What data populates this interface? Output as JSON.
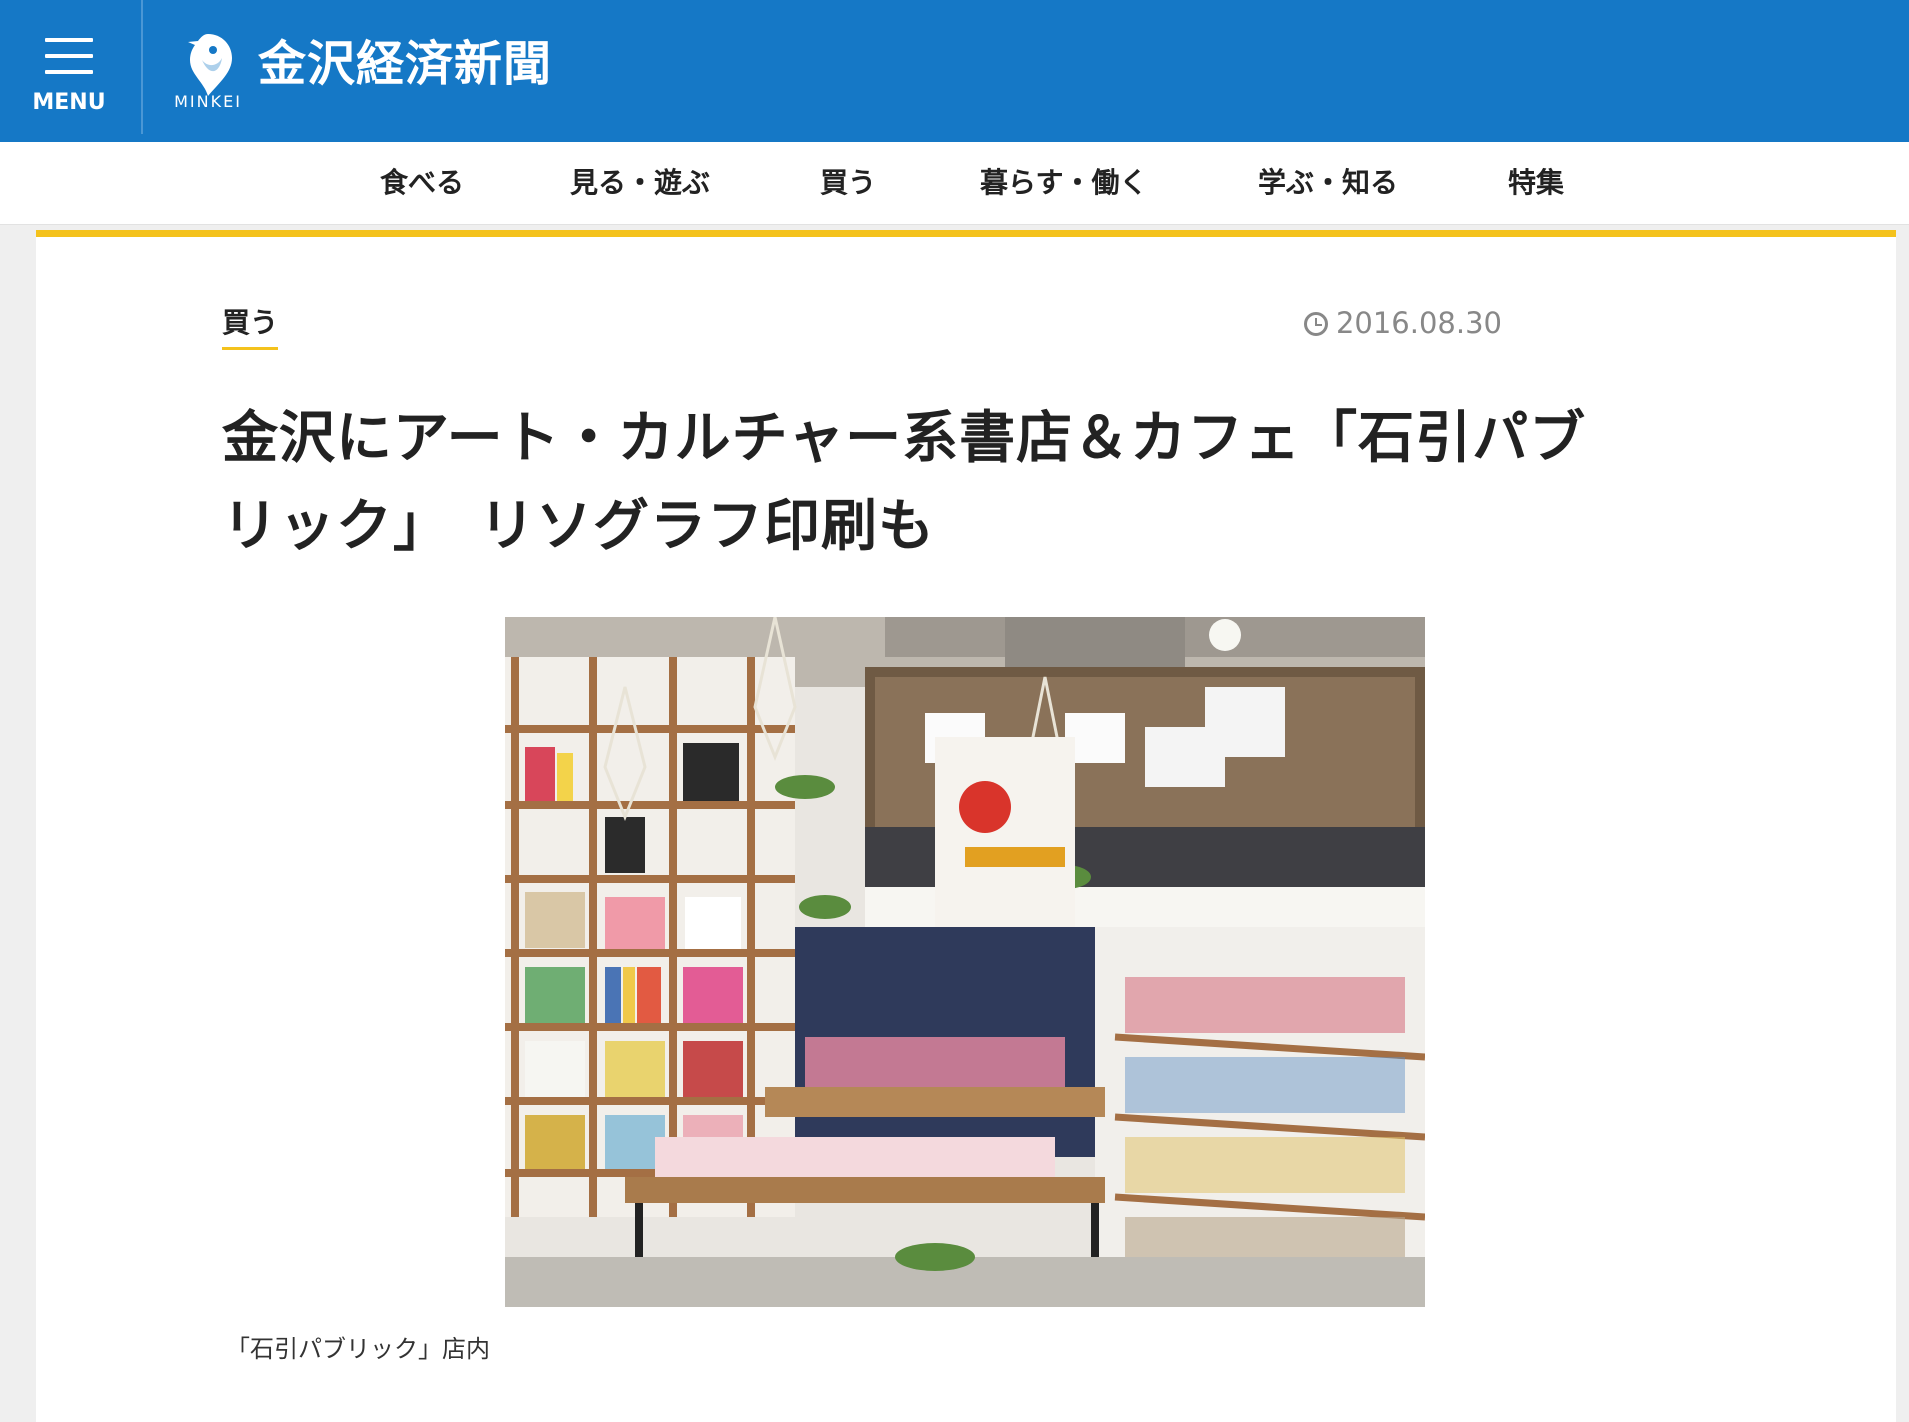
{
  "header": {
    "menu_label": "MENU",
    "logo_sub": "MINKEI",
    "site_title": "金沢経済新聞",
    "bg_color": "#1578c6"
  },
  "nav": {
    "items": [
      "食べる",
      "見る・遊ぶ",
      "買う",
      "暮らす・働く",
      "学ぶ・知る",
      "特集"
    ]
  },
  "article": {
    "category": "買う",
    "date": "2016.08.30",
    "headline_line1": "金沢にアート・カルチャー系書店＆カフェ「石引パブ",
    "headline_line2": "リック」　リソグラフ印刷も",
    "caption": "「石引パブリック」店内",
    "accent_color": "#f4c21c",
    "icons": {
      "date": "clock-icon",
      "logo": "bird-pin-icon",
      "menu": "hamburger-icon"
    }
  }
}
